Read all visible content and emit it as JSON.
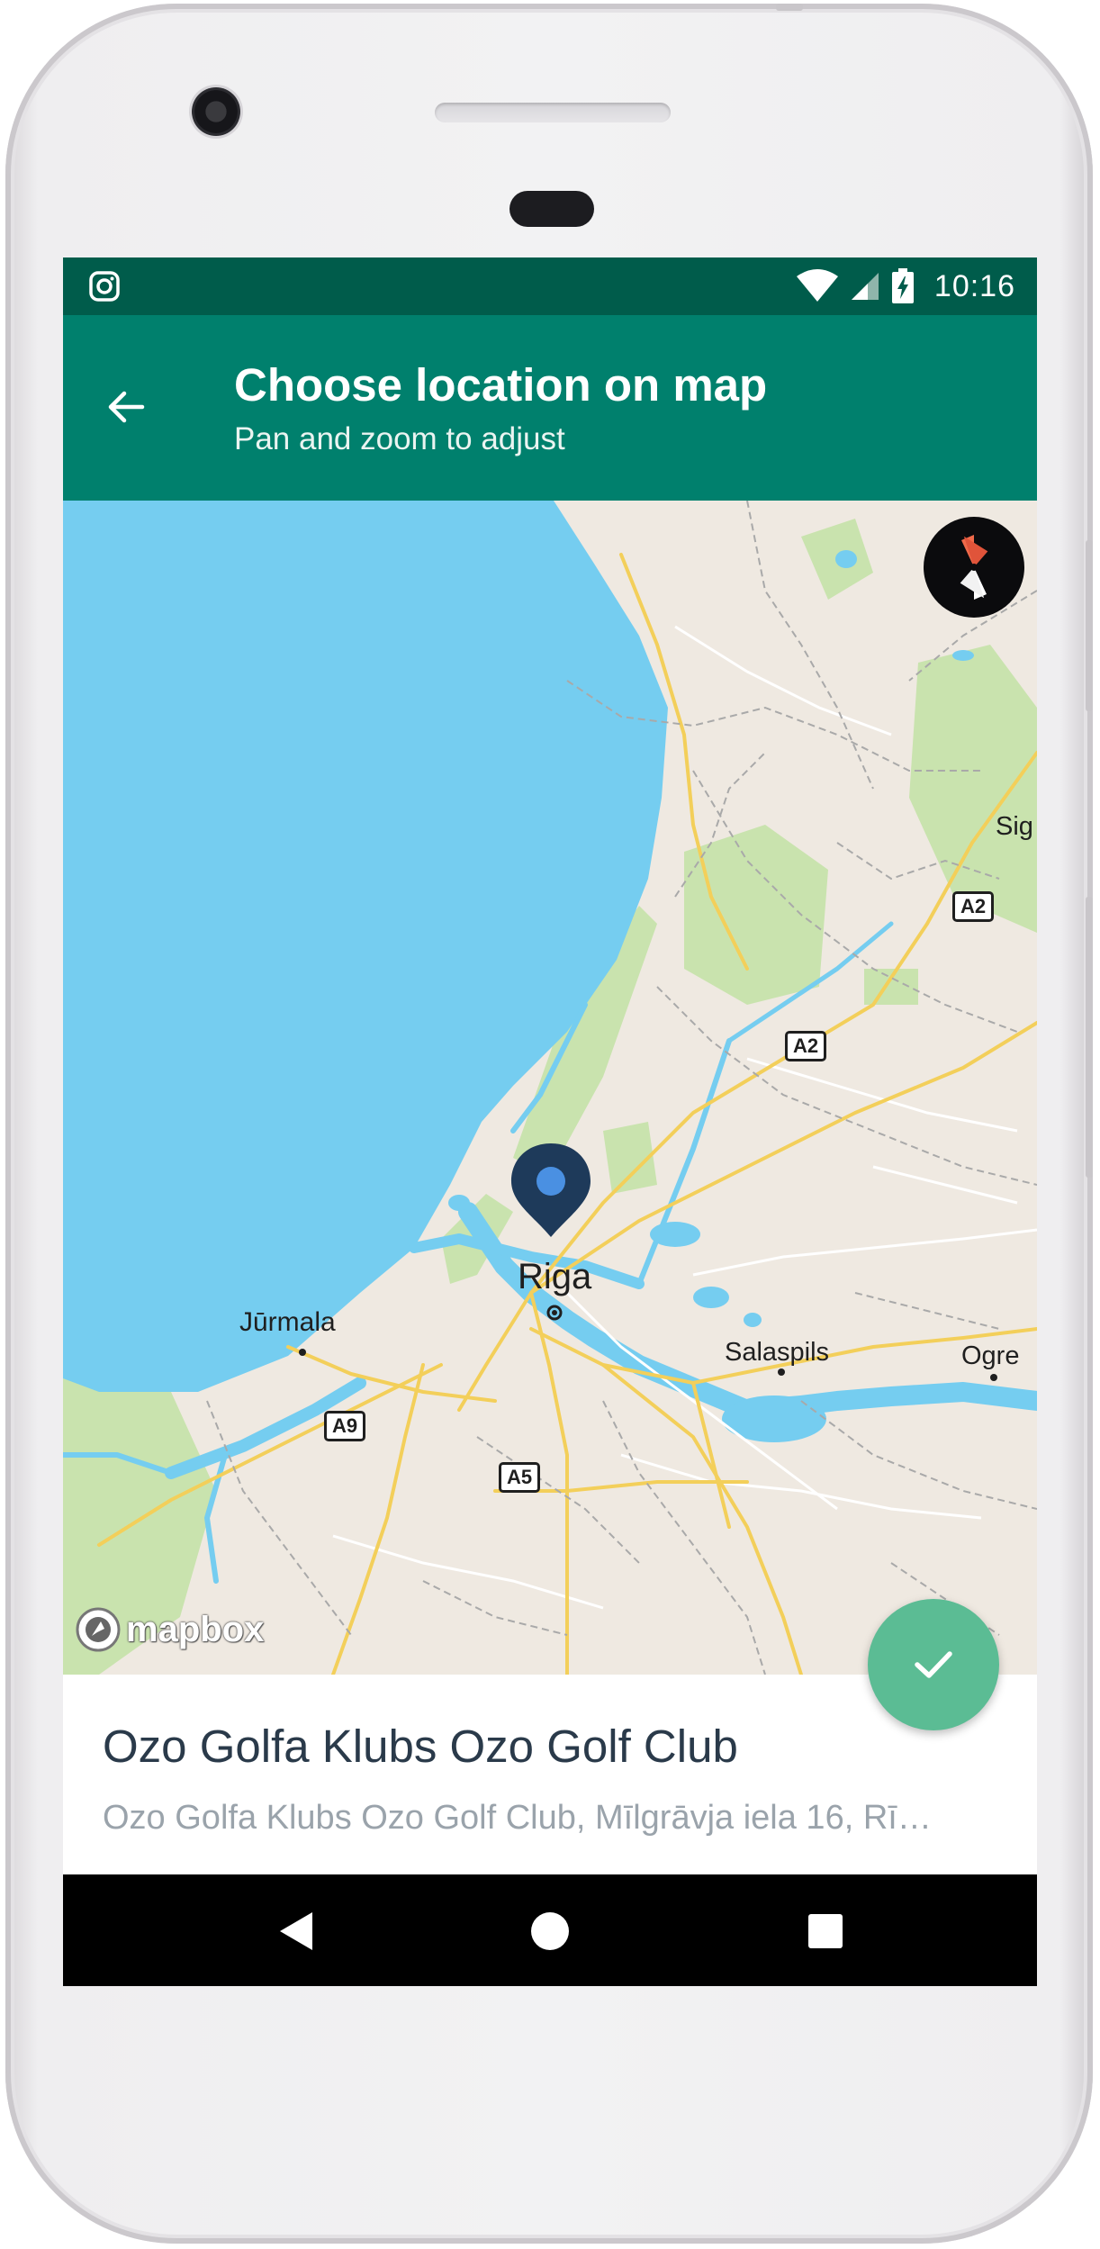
{
  "status_bar": {
    "notification_icon": "instagram-icon",
    "wifi_icon": "wifi-icon",
    "signal_icon": "cell-signal-icon",
    "battery_icon": "battery-charging-icon",
    "time": "10:16"
  },
  "app_bar": {
    "back_icon": "arrow-back-icon",
    "title": "Choose location on map",
    "subtitle": "Pan and zoom to adjust",
    "background_color": "#00806d",
    "status_color": "#005c4b"
  },
  "map": {
    "compass_icon": "compass-icon",
    "pin_icon": "location-pin-icon",
    "places": [
      {
        "label": "Riga"
      },
      {
        "label": "Jūrmala"
      },
      {
        "label": "Salaspils"
      },
      {
        "label": "Ogre"
      },
      {
        "label": "Sig"
      }
    ],
    "road_shields": [
      "A2",
      "A2",
      "A9",
      "A5"
    ],
    "attribution": "mapbox",
    "colors": {
      "water": "#75cdf0",
      "land": "#efe9e1",
      "park": "#c9e3ae",
      "road": "#f3cf5a"
    }
  },
  "location": {
    "name": "Ozo Golfa Klubs   Ozo Golf Club",
    "address": "Ozo Golfa Klubs  Ozo Golf Club, Mīlgrāvja iela 16, Rī…"
  },
  "confirm_button": {
    "icon": "checkmark-icon",
    "color": "#5bbc94"
  },
  "nav_bar": {
    "back_icon": "nav-back-icon",
    "home_icon": "nav-home-icon",
    "recents_icon": "nav-recents-icon"
  }
}
